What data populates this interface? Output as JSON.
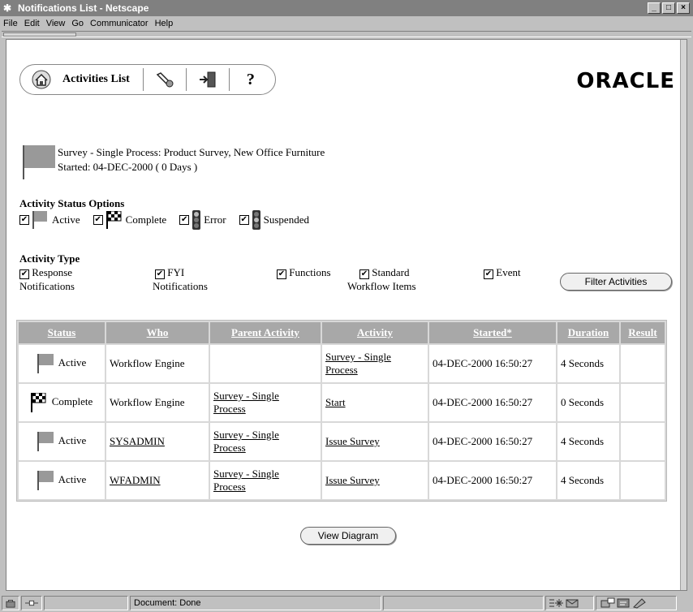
{
  "window": {
    "title": "Notifications List - Netscape",
    "menu": [
      "File",
      "Edit",
      "View",
      "Go",
      "Communicator",
      "Help"
    ],
    "buttons": {
      "minimize": "_",
      "maximize": "□",
      "close": "×"
    }
  },
  "toolbar": {
    "title": "Activities List",
    "icons": [
      "home-icon",
      "preferences-icon",
      "logout-icon",
      "help-icon"
    ],
    "help_glyph": "?",
    "logo": "ORACLE"
  },
  "process": {
    "line1": "Survey - Single Process: Product Survey, New Office Furniture",
    "line2": "Started: 04-DEC-2000 ( 0 Days )"
  },
  "status_options": {
    "heading": "Activity Status Options",
    "items": [
      {
        "label": "Active",
        "checked": true,
        "icon": "active-flag-icon"
      },
      {
        "label": "Complete",
        "checked": true,
        "icon": "complete-flag-icon"
      },
      {
        "label": "Error",
        "checked": true,
        "icon": "error-traffic-light-icon"
      },
      {
        "label": "Suspended",
        "checked": true,
        "icon": "suspended-traffic-light-icon"
      }
    ]
  },
  "activity_type": {
    "heading": "Activity Type",
    "items": [
      {
        "label1": "Response",
        "label2": "Notifications",
        "checked": true
      },
      {
        "label1": "FYI",
        "label2": "Notifications",
        "checked": true
      },
      {
        "label1": "Functions",
        "label2": "",
        "checked": true
      },
      {
        "label1": "Standard",
        "label2": "Workflow Items",
        "checked": true
      },
      {
        "label1": "Event",
        "label2": "",
        "checked": true
      }
    ],
    "filter_button": "Filter Activities"
  },
  "table": {
    "headers": [
      "Status",
      "Who",
      "Parent Activity",
      "Activity",
      "Started*",
      "Duration",
      "Result"
    ],
    "rows": [
      {
        "status": "Active",
        "who": "Workflow Engine",
        "parent1": "",
        "parent2": "",
        "act1": "Survey - Single",
        "act2": "Process",
        "started": "04-DEC-2000 16:50:27",
        "duration": "4 Seconds",
        "result": ""
      },
      {
        "status": "Complete",
        "who": "Workflow Engine",
        "parent1": "Survey - Single",
        "parent2": "Process",
        "act1": "Start",
        "act2": "",
        "started": "04-DEC-2000 16:50:27",
        "duration": "0 Seconds",
        "result": ""
      },
      {
        "status": "Active",
        "who": "SYSADMIN",
        "parent1": "Survey - Single",
        "parent2": "Process",
        "act1": "Issue Survey",
        "act2": "",
        "started": "04-DEC-2000 16:50:27",
        "duration": "4 Seconds",
        "result": ""
      },
      {
        "status": "Active",
        "who": "WFADMIN",
        "parent1": "Survey - Single",
        "parent2": "Process",
        "act1": "Issue Survey",
        "act2": "",
        "started": "04-DEC-2000 16:50:27",
        "duration": "4 Seconds",
        "result": ""
      }
    ]
  },
  "view_diagram": "View Diagram",
  "statusbar": {
    "text": "Document: Done"
  },
  "checkmark": "✔"
}
